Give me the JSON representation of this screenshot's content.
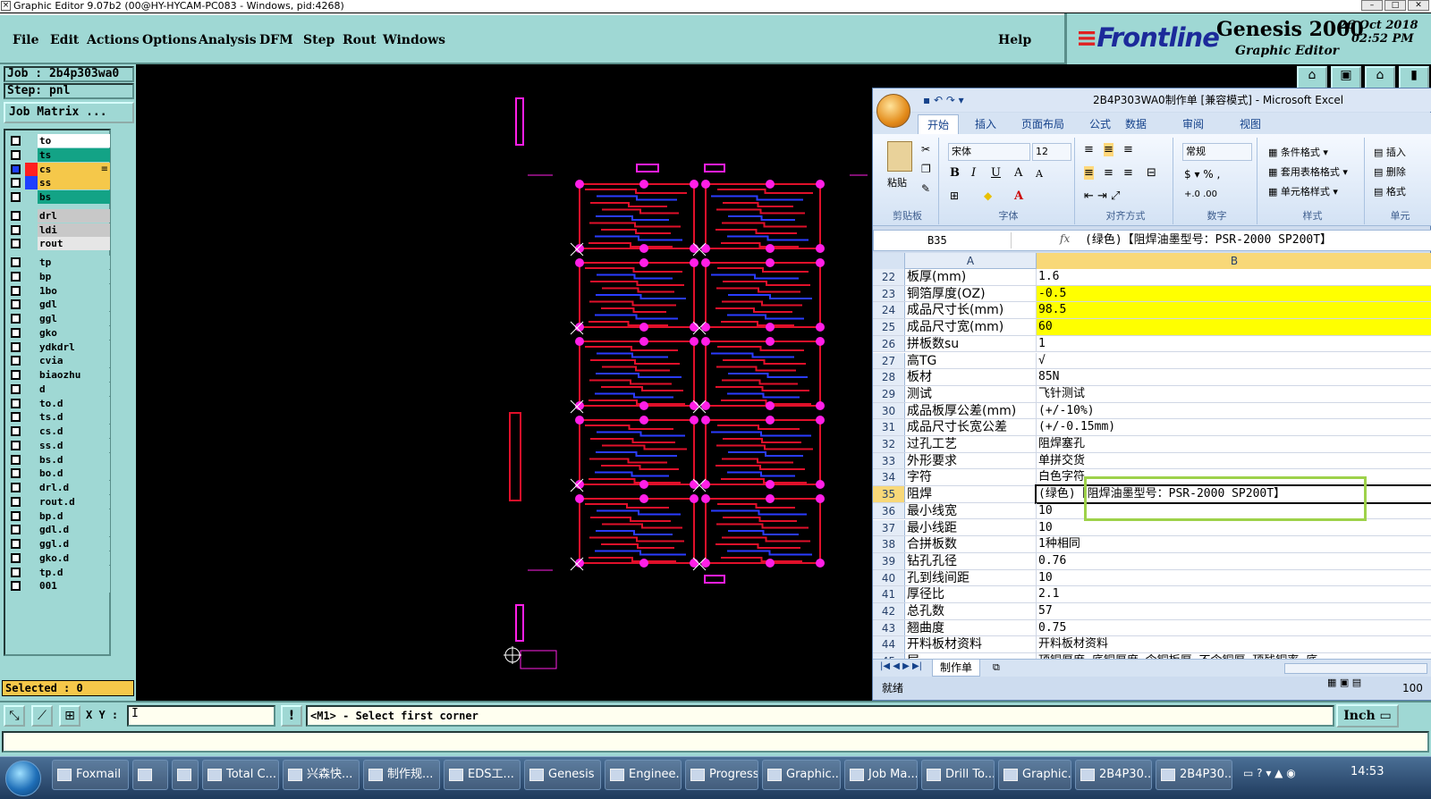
{
  "window": {
    "title": "Graphic Editor 9.07b2 (00@HY-HYCAM-PC083 - Windows, pid:4268)"
  },
  "menu": [
    "File",
    "Edit",
    "Actions",
    "Options",
    "Analysis",
    "DFM",
    "Step",
    "Rout",
    "Windows"
  ],
  "help_label": "Help",
  "brand": {
    "logo": "Frontline",
    "product": "Genesis 2000",
    "subtitle": "Graphic Editor",
    "date": "26 Oct 2018",
    "time": "02:52 PM"
  },
  "job": {
    "job_line": "Job : 2b4p303wa0",
    "step_line": "Step: pnl",
    "matrix_button": "Job Matrix ..."
  },
  "layers": [
    {
      "name": "to",
      "color": "#ffffff"
    },
    {
      "name": "ts",
      "color": "#13a386"
    },
    {
      "name": "cs",
      "color": "#f5c84a",
      "swatch": "#ff1f1f",
      "active": true,
      "marker": "≡"
    },
    {
      "name": "ss",
      "color": "#f5c84a",
      "swatch": "#1f3fff"
    },
    {
      "name": "bs",
      "color": "#13a386"
    },
    {
      "name": "drl",
      "color": "#c8c8c8",
      "gap": true
    },
    {
      "name": "ldi",
      "color": "#c8c8c8"
    },
    {
      "name": "rout",
      "color": "#e6e6e6"
    },
    {
      "name": "tp",
      "color": "#9fd8d4",
      "gap": true
    },
    {
      "name": "bp",
      "color": "#9fd8d4"
    },
    {
      "name": "1bo",
      "color": "#9fd8d4"
    },
    {
      "name": "gdl",
      "color": "#9fd8d4"
    },
    {
      "name": "ggl",
      "color": "#9fd8d4"
    },
    {
      "name": "gko",
      "color": "#9fd8d4"
    },
    {
      "name": "ydkdrl",
      "color": "#9fd8d4"
    },
    {
      "name": "cvia",
      "color": "#9fd8d4"
    },
    {
      "name": "biaozhu",
      "color": "#9fd8d4"
    },
    {
      "name": "d",
      "color": "#9fd8d4"
    },
    {
      "name": "to.d",
      "color": "#9fd8d4"
    },
    {
      "name": "ts.d",
      "color": "#9fd8d4"
    },
    {
      "name": "cs.d",
      "color": "#9fd8d4"
    },
    {
      "name": "ss.d",
      "color": "#9fd8d4"
    },
    {
      "name": "bs.d",
      "color": "#9fd8d4"
    },
    {
      "name": "bo.d",
      "color": "#9fd8d4"
    },
    {
      "name": "drl.d",
      "color": "#9fd8d4"
    },
    {
      "name": "rout.d",
      "color": "#9fd8d4"
    },
    {
      "name": "bp.d",
      "color": "#9fd8d4"
    },
    {
      "name": "gdl.d",
      "color": "#9fd8d4"
    },
    {
      "name": "ggl.d",
      "color": "#9fd8d4"
    },
    {
      "name": "gko.d",
      "color": "#9fd8d4"
    },
    {
      "name": "tp.d",
      "color": "#9fd8d4"
    },
    {
      "name": "001",
      "color": "#9fd8d4"
    }
  ],
  "selected": "Selected : 0",
  "cmd": {
    "xy_label": "X Y :",
    "xy_value": "I",
    "warn": "!",
    "message": "<M1> - Select first corner",
    "unit": "Inch"
  },
  "pcb": {
    "board_colors": {
      "trace": "#e0102a",
      "trace2": "#2a3cff",
      "pad": "#ff1fe6"
    }
  },
  "excel": {
    "title": "2B4P303WA0制作单  [兼容模式] - Microsoft Excel",
    "tabs": [
      "开始",
      "插入",
      "页面布局",
      "公式",
      "数据",
      "审阅",
      "视图"
    ],
    "groups": {
      "clipboard": "剪贴板",
      "paste": "粘贴",
      "font": "字体",
      "font_name": "宋体",
      "font_size": "12",
      "align": "对齐方式",
      "number": "数字",
      "number_format": "常规",
      "styles": "样式",
      "cond": "条件格式",
      "table": "套用表格格式",
      "cell": "单元格样式",
      "cells": "单元",
      "insert": "插入",
      "delete": "删除",
      "format": "格式"
    },
    "namebox": "B35",
    "formula": "(绿色)【阻焊油墨型号：PSR-2000 SP200T】",
    "col_a": "A",
    "col_b": "B",
    "rows": [
      {
        "n": "22",
        "a": "板厚(mm)",
        "b": "1.6"
      },
      {
        "n": "23",
        "a": "铜箔厚度(OZ)",
        "b": "-0.5",
        "hl": "#ffff00"
      },
      {
        "n": "24",
        "a": "成品尺寸长(mm)",
        "b": "98.5",
        "hl": "#ffff00"
      },
      {
        "n": "25",
        "a": "成品尺寸宽(mm)",
        "b": "60",
        "hl": "#ffff00"
      },
      {
        "n": "26",
        "a": "拼板数su",
        "b": "1"
      },
      {
        "n": "27",
        "a": "高TG",
        "b": "√"
      },
      {
        "n": "28",
        "a": "板材",
        "b": "85N"
      },
      {
        "n": "29",
        "a": "测试",
        "b": "飞针测试"
      },
      {
        "n": "30",
        "a": "成品板厚公差(mm)",
        "b": "(+/-10%)"
      },
      {
        "n": "31",
        "a": "成品尺寸长宽公差",
        "b": "(+/-0.15mm)"
      },
      {
        "n": "32",
        "a": "过孔工艺",
        "b": "阻焊塞孔"
      },
      {
        "n": "33",
        "a": "外形要求",
        "b": "单拼交货"
      },
      {
        "n": "34",
        "a": "字符",
        "b": "白色字符"
      },
      {
        "n": "35",
        "a": "阻焊",
        "b": "(绿色)【阻焊油墨型号：PSR-2000 SP200T】",
        "active": true
      },
      {
        "n": "36",
        "a": "最小线宽",
        "b": "10"
      },
      {
        "n": "37",
        "a": "最小线距",
        "b": "10"
      },
      {
        "n": "38",
        "a": "合拼板数",
        "b": "1种相同"
      },
      {
        "n": "39",
        "a": "钻孔孔径",
        "b": "0.76"
      },
      {
        "n": "40",
        "a": "孔到线间距",
        "b": "10"
      },
      {
        "n": "41",
        "a": "厚径比",
        "b": "2.1"
      },
      {
        "n": "42",
        "a": "总孔数",
        "b": "57"
      },
      {
        "n": "43",
        "a": "翘曲度",
        "b": "0.75"
      },
      {
        "n": "44",
        "a": "开料板材资料",
        "b": "开料板材资料"
      },
      {
        "n": "45",
        "a": "层",
        "b": "顶铜厚度  底铜厚度  含铜板厚  不含铜厚  顶残铜率  底"
      }
    ],
    "sheet_tab": "制作单",
    "status": "就绪",
    "zoom": "100"
  },
  "taskbar": {
    "items": [
      "Foxmail",
      "",
      "",
      "Total C...",
      "兴森快...",
      "制作规...",
      "EDS工...",
      "Genesis",
      "Enginee...",
      "Progress",
      "Graphic...",
      "Job Ma...",
      "Drill To...",
      "Graphic...",
      "2B4P30...",
      "2B4P30..."
    ],
    "time": "14:53"
  }
}
